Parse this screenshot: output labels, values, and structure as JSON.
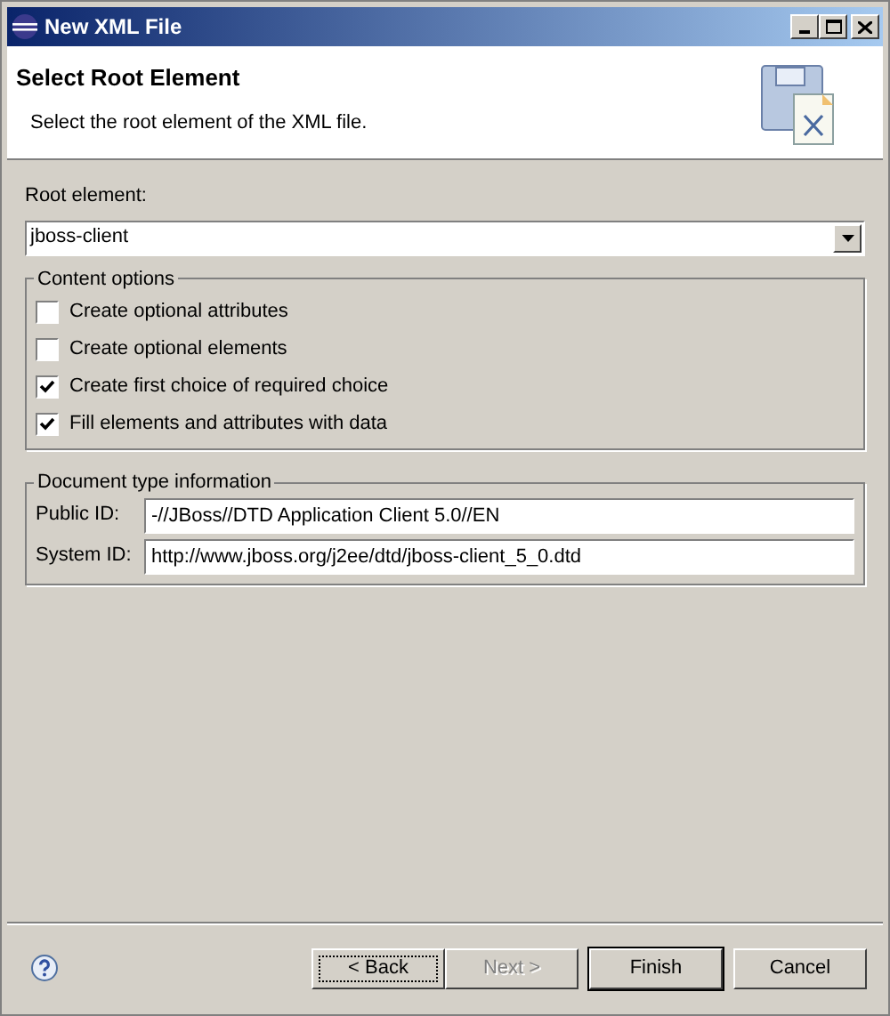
{
  "window": {
    "title": "New XML File"
  },
  "header": {
    "title": "Select Root Element",
    "description": "Select the root element of the XML file."
  },
  "root_element": {
    "label": "Root element:",
    "value": "jboss-client"
  },
  "content_options": {
    "title": "Content options",
    "options": [
      {
        "label": "Create optional attributes",
        "checked": false
      },
      {
        "label": "Create optional elements",
        "checked": false
      },
      {
        "label": "Create first choice of required choice",
        "checked": true
      },
      {
        "label": "Fill elements and attributes with data",
        "checked": true
      }
    ]
  },
  "document_type": {
    "title": "Document type information",
    "fields": [
      {
        "label": "Public ID:",
        "value": "-//JBoss//DTD Application Client 5.0//EN"
      },
      {
        "label": "System ID:",
        "value": "http://www.jboss.org/j2ee/dtd/jboss-client_5_0.dtd"
      }
    ]
  },
  "buttons": [
    {
      "label": "< Back",
      "disabled": false,
      "focused": true,
      "default": false
    },
    {
      "label": "Next >",
      "disabled": true,
      "focused": false,
      "default": false
    },
    {
      "label": "Finish",
      "disabled": false,
      "focused": false,
      "default": true
    },
    {
      "label": "Cancel",
      "disabled": false,
      "focused": false,
      "default": false
    }
  ]
}
